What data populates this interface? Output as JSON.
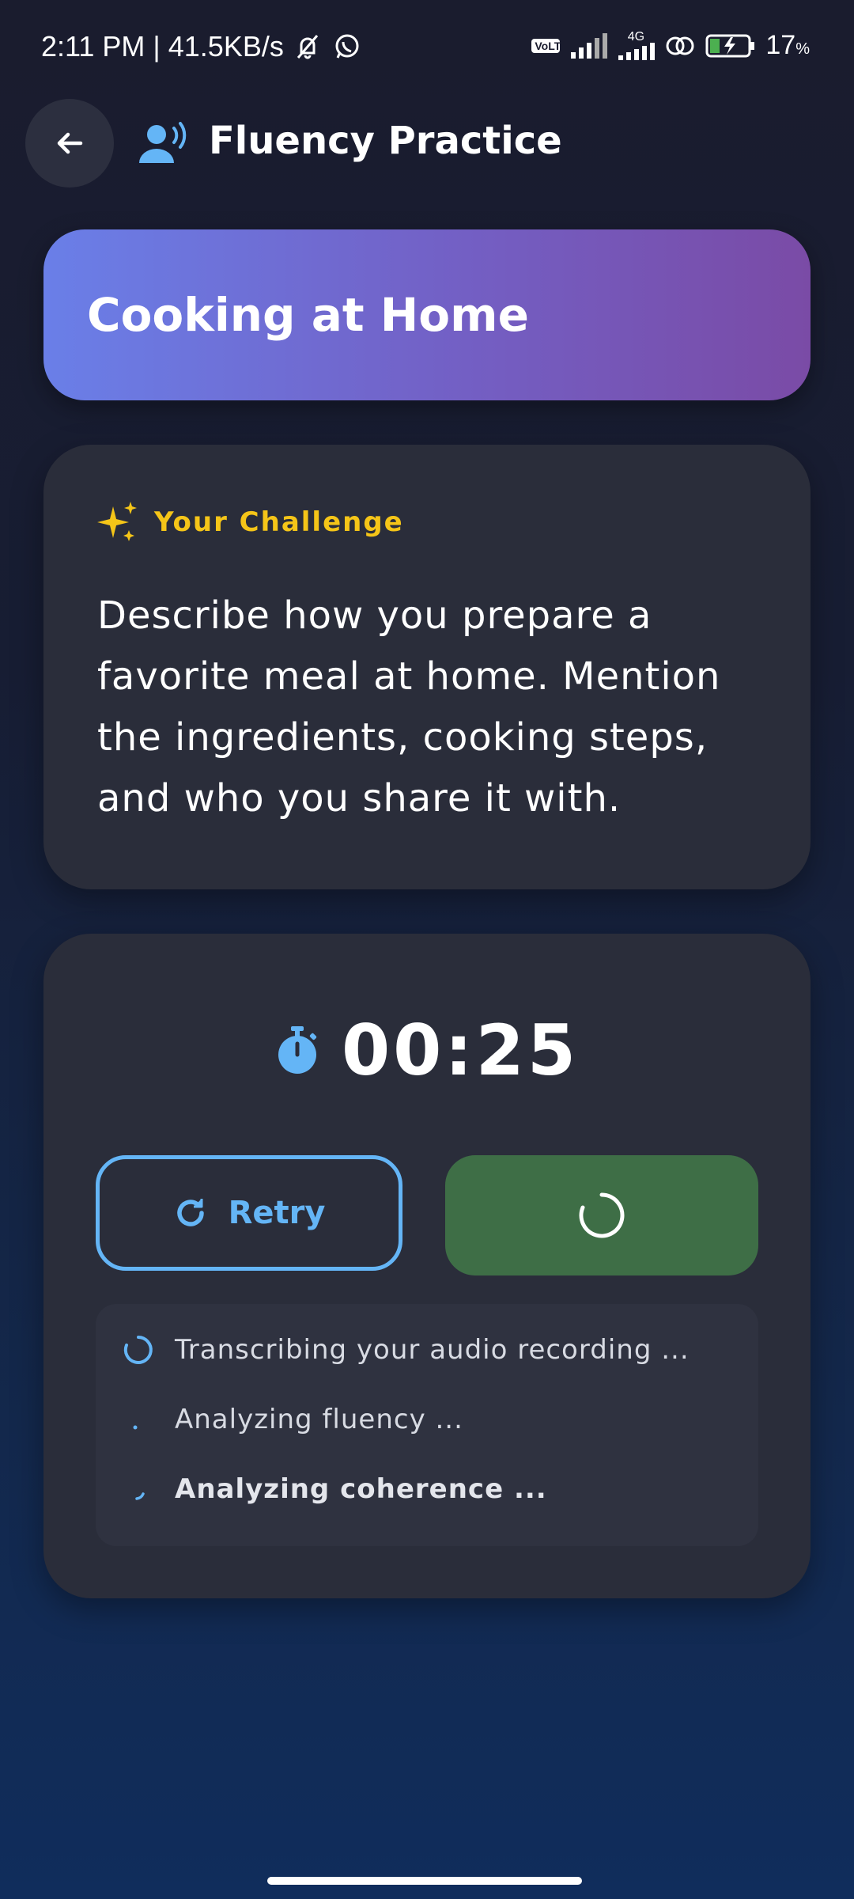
{
  "status_bar": {
    "time": "2:11 PM",
    "separator": "|",
    "speed": "41.5KB/s",
    "volte": "VoLTE",
    "network": "4G",
    "battery": "17",
    "battery_unit": "%"
  },
  "header": {
    "title": "Fluency Practice"
  },
  "topic": {
    "title": "Cooking at Home"
  },
  "challenge": {
    "label": "Your Challenge",
    "text": "Describe how you prepare a favorite meal at home. Mention the ingredients, cooking steps, and who you share it with."
  },
  "recorder": {
    "timer": "00:25",
    "retry_label": "Retry"
  },
  "progress": {
    "steps": [
      {
        "label": "Transcribing your audio recording ..."
      },
      {
        "label": "Analyzing fluency ..."
      },
      {
        "label": "Analyzing coherence ..."
      }
    ]
  },
  "colors": {
    "accent_blue": "#64b5f6",
    "challenge_yellow": "#f5c518",
    "submit_green": "#3e6e46",
    "card_bg": "#2a2d3a",
    "banner_start": "#6a7fe8",
    "banner_end": "#7a4ba6"
  },
  "icons": {
    "back": "arrow-left-icon",
    "header": "speaking-person-icon",
    "challenge": "sparkles-icon",
    "timer": "stopwatch-icon",
    "retry": "refresh-icon",
    "submit": "loading-spinner-icon"
  }
}
